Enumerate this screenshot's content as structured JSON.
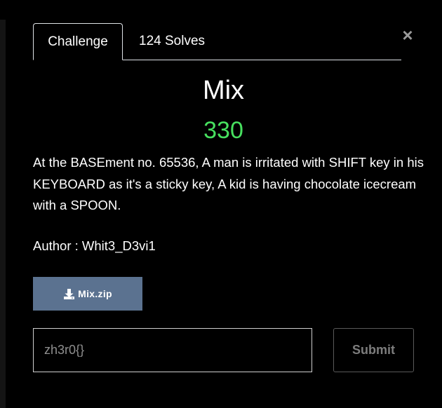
{
  "modal": {
    "close_glyph": "×",
    "tabs": [
      {
        "label": "Challenge",
        "active": true
      },
      {
        "label": "124 Solves",
        "active": false
      }
    ],
    "challenge": {
      "name": "Mix",
      "points": "330",
      "description": "At the BASEment no. 65536, A man is irritated with SHIFT key in his KEYBOARD as it's a sticky key, A kid is having chocolate icecream with a SPOON.",
      "author": "Author : Whit3_D3vi1"
    },
    "file": {
      "icon": "download-icon",
      "label": "Mix.zip"
    },
    "flag_input": {
      "placeholder": "zh3r0{}",
      "value": ""
    },
    "submit_label": "Submit"
  },
  "colors": {
    "background": "#000000",
    "points": "#47e05f",
    "download_button": "#5b7290",
    "close_icon": "#9a9a9a",
    "submit_text": "#7d7d7d"
  }
}
